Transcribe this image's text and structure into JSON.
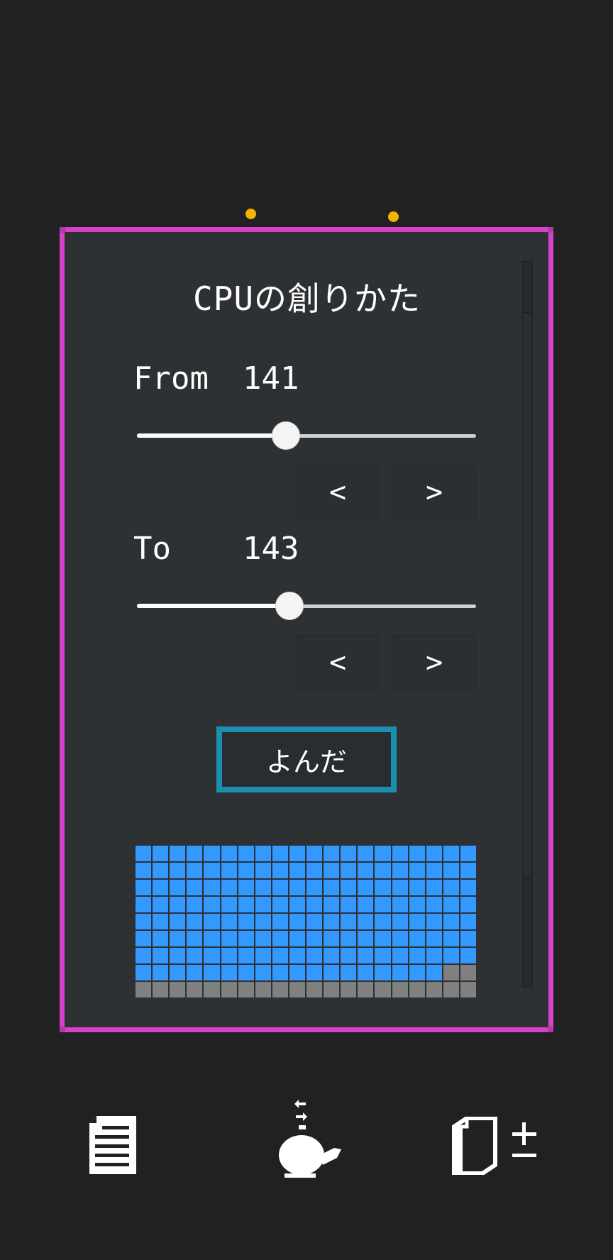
{
  "panel": {
    "title": "CPUの創りかた",
    "from": {
      "label": "From",
      "value": "141",
      "slider_fraction": 0.44,
      "prev_label": "<",
      "next_label": ">"
    },
    "to": {
      "label": "To",
      "value": "143",
      "slider_fraction": 0.45,
      "prev_label": "<",
      "next_label": ">"
    },
    "read_button_label": "よんだ",
    "progress": {
      "columns": 20,
      "total_cells": 180,
      "read_cells": 158
    }
  },
  "colors": {
    "background": "#212121",
    "frame": "#d542c7",
    "panel": "#2e3133",
    "dots": "#f2b400",
    "read_button_border": "#1b8fb0",
    "progress_read": "#3399ff",
    "progress_unread": "#808080"
  },
  "bottom_bar": {
    "items": [
      {
        "icon": "document-icon"
      },
      {
        "icon": "kettle-icon"
      },
      {
        "icon": "cup-plus-minus-icon"
      }
    ]
  }
}
